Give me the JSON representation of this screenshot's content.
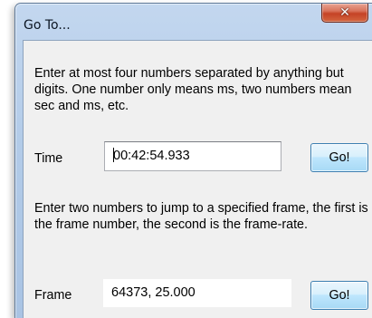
{
  "window": {
    "title": "Go To...",
    "close_glyph": "✕"
  },
  "time_section": {
    "description": "Enter at most four numbers separated by anything but digits. One number only means ms, two numbers mean sec and ms, etc.",
    "label": "Time",
    "value": "00:42:54.933",
    "button_label": "Go!"
  },
  "frame_section": {
    "description": "Enter two numbers to jump to a specified frame, the first is the frame number, the second is the frame-rate.",
    "label": "Frame",
    "value": "64373, 25.000",
    "button_label": "Go!"
  }
}
